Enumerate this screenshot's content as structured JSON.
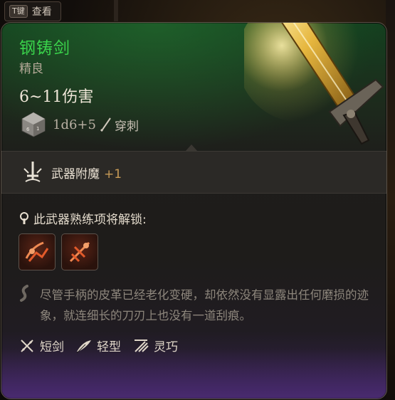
{
  "topbar": {
    "key": "T键",
    "label": "查看"
  },
  "item": {
    "name": "钢铸剑",
    "rarity": "精良",
    "damage": "6~11伤害",
    "dice": "1d6+5",
    "damage_type": "穿刺",
    "name_color": "#3ad24b"
  },
  "enchant": {
    "label": "武器附魔",
    "bonus": "+1"
  },
  "proficiency": {
    "label": "此武器熟练项将解锁:"
  },
  "actions": [
    {
      "icon": "slash-attack-icon"
    },
    {
      "icon": "pierce-attack-icon"
    }
  ],
  "flavor": "尽管手柄的皮革已经老化变硬，却依然没有显露出任何磨损的迹象，就连细长的刀刃上也没有一道刮痕。",
  "tags": [
    {
      "icon": "shortsword-icon",
      "label": "短剑"
    },
    {
      "icon": "light-feather-icon",
      "label": "轻型"
    },
    {
      "icon": "finesse-icon",
      "label": "灵巧"
    }
  ]
}
